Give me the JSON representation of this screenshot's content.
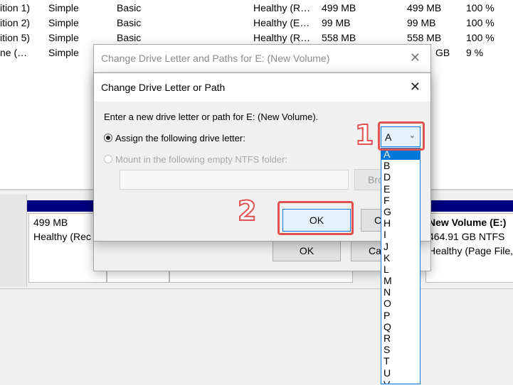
{
  "volume_table": {
    "rows": [
      {
        "name": "ition 1)",
        "layout": "Simple",
        "type": "Basic",
        "status": "Healthy (R…",
        "capacity": "499 MB",
        "free": "499 MB",
        "pct": "100 %"
      },
      {
        "name": "ition 2)",
        "layout": "Simple",
        "type": "Basic",
        "status": "Healthy (E…",
        "capacity": "99 MB",
        "free": "99 MB",
        "pct": "100 %"
      },
      {
        "name": "ition 5)",
        "layout": "Simple",
        "type": "Basic",
        "status": "Healthy (R…",
        "capacity": "558 MB",
        "free": "558 MB",
        "pct": "100 %"
      },
      {
        "name": "ne (…",
        "layout": "Simple",
        "type": "",
        "status": "",
        "capacity": "",
        "free": "GB",
        "pct": "9 %"
      }
    ]
  },
  "disk_map": {
    "partition_left": {
      "size": "499 MB",
      "status": "Healthy (Rec"
    },
    "partition_right": {
      "name": "New Volume  (E:)",
      "size": "464.91 GB NTFS",
      "status": "Healthy (Page File,"
    }
  },
  "outer_dialog": {
    "title": "Change Drive Letter and Paths for E: (New Volume)",
    "close": "✕",
    "ok_label": "OK",
    "cancel_label": "Ca"
  },
  "inner_dialog": {
    "title": "Change Drive Letter or Path",
    "close": "✕",
    "instruction": "Enter a new drive letter or path for E: (New Volume).",
    "option_assign": "Assign the following drive letter:",
    "option_mount": "Mount in the following empty NTFS folder:",
    "browse_label": "Bro",
    "ok_label": "OK",
    "cancel_label": "C"
  },
  "drive_combo": {
    "value": "A",
    "arrow": "⌄",
    "options": [
      "A",
      "B",
      "D",
      "E",
      "F",
      "G",
      "H",
      "I",
      "J",
      "K",
      "L",
      "M",
      "N",
      "O",
      "P",
      "Q",
      "R",
      "S",
      "T",
      "U",
      "V"
    ],
    "selected_index": 0
  },
  "annotations": {
    "step1": "1",
    "step2": "2",
    "color": "#e05252"
  }
}
